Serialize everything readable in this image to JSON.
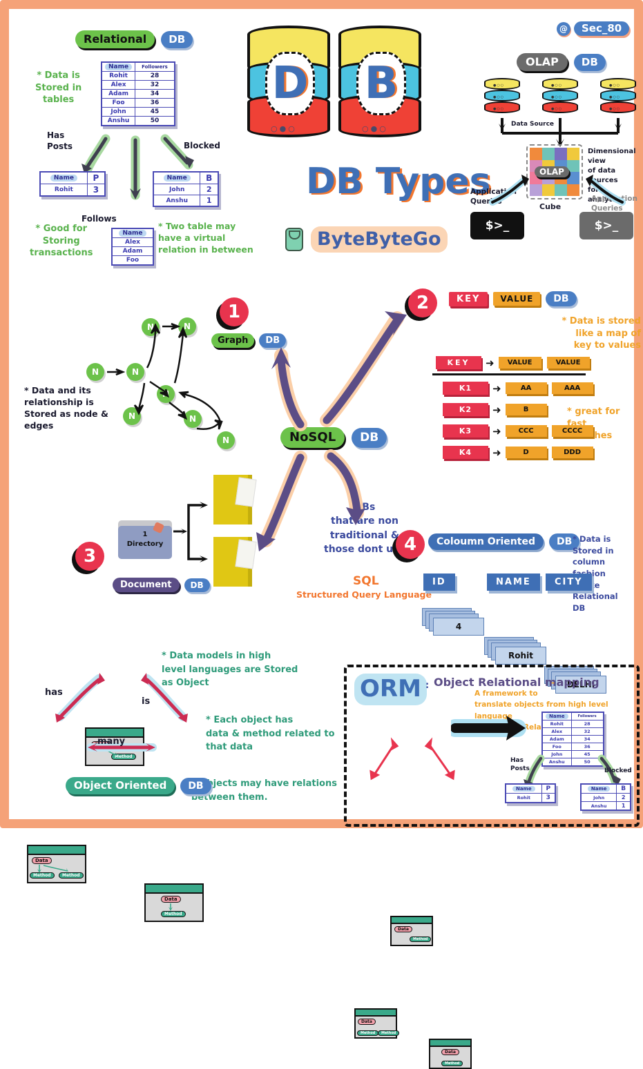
{
  "page": {
    "title": "DB Types",
    "brand": "ByteByteGo",
    "handle": "Sec_80",
    "at_symbol": "@",
    "frame_color": "#f5a278"
  },
  "relational": {
    "badge": "Relational",
    "db_badge": "DB",
    "note_left": "* Data is\nStored in\ntables",
    "note_bottom_left": "* Good for\nStoring\ntransactions",
    "note_right": "* Two table may\nhave a virtual\nrelation in between",
    "arrow_labels": {
      "left": "Has\nPosts",
      "center": "Follows",
      "right": "Blocked"
    },
    "main_table": {
      "headers": [
        "Name",
        "Followers"
      ],
      "rows": [
        [
          "Rohit",
          "28"
        ],
        [
          "Alex",
          "32"
        ],
        [
          "Adam",
          "34"
        ],
        [
          "Foo",
          "36"
        ],
        [
          "John",
          "45"
        ],
        [
          "Anshu",
          "50"
        ]
      ]
    },
    "posts_table": {
      "headers": [
        "Name",
        "P"
      ],
      "rows": [
        [
          "Rohit",
          "3"
        ]
      ]
    },
    "blocked_table": {
      "headers": [
        "Name",
        "B"
      ],
      "rows": [
        [
          "John",
          "2"
        ],
        [
          "Anshu",
          "1"
        ]
      ]
    },
    "follows_table": {
      "headers": [
        "Name"
      ],
      "rows": [
        [
          "Alex"
        ],
        [
          "Adam"
        ],
        [
          "Foo"
        ]
      ]
    }
  },
  "olap": {
    "badge": "OLAP",
    "db_badge": "DB",
    "data_source_label": "Data Source",
    "cube_label": "OLAP",
    "cube_caption": "Cube",
    "dimensional_note": "Dimensional view\nof data sources\nfor analytics",
    "query_left": "Application\nQueries",
    "query_right": "Application\nQueries",
    "terminal_prompt": "$>_"
  },
  "graph": {
    "step": "1",
    "badge": "Graph",
    "db_badge": "DB",
    "note": "* Data and its\nrelationship is\nStored as node &\nedges",
    "node_label": "N"
  },
  "keyvalue": {
    "step": "2",
    "key_badge": "KEY",
    "value_badge": "VALUE",
    "db_badge": "DB",
    "note_top": "* Data is stored\nlike a map of\nkey to values",
    "note_bottom": "* great for\nfast searches",
    "header_row": {
      "key": "KEY",
      "values": [
        "VALUE",
        "VALUE"
      ]
    },
    "rows": [
      {
        "key": "K1",
        "values": [
          "AA",
          "AAA"
        ]
      },
      {
        "key": "K2",
        "values": [
          "B"
        ]
      },
      {
        "key": "K3",
        "values": [
          "CCC",
          "CCCC"
        ]
      },
      {
        "key": "K4",
        "values": [
          "D",
          "DDD"
        ]
      }
    ]
  },
  "document": {
    "step": "3",
    "badge": "Document",
    "db_badge": "DB",
    "folder_label": "1\nDirectory"
  },
  "nosql": {
    "badge": "NoSQL",
    "db_badge": "DB",
    "description": "DBs\nthat are non\ntraditional &\nthose dont use",
    "sql_word": "SQL",
    "sql_expansion": "Structured Query Language"
  },
  "column": {
    "step": "4",
    "badge": "Coloumn Oriented",
    "db_badge": "DB",
    "note": "* Data is\nStored in column\nfashion unlike\nRelational\nDB",
    "columns": [
      {
        "header": "ID",
        "value": "4"
      },
      {
        "header": "NAME",
        "value": "Rohit"
      },
      {
        "header": "CITY",
        "value": "DELHI"
      }
    ]
  },
  "object_oriented": {
    "badge": "Object Oriented",
    "db_badge": "DB",
    "note_1": "* Data models in high\nlevel languages are Stored\nas Object",
    "note_2": "* Each object has\ndata & method related to\nthat data",
    "note_3": "* Objects may have relations\nbetween them.",
    "relations": {
      "has": "has",
      "is": "is",
      "many": "many"
    },
    "box_labels": {
      "data": "Data",
      "method": "Method"
    }
  },
  "orm": {
    "title": "ORM",
    "separator": ":",
    "definition": "Object Relational mapping",
    "dash": "-",
    "description": "A framework to\ntranslate objects from high level language\nto tables in Relational DB",
    "box_labels": {
      "data": "Data",
      "method": "Method"
    },
    "arrow_labels": {
      "left": "Has\nPosts",
      "right": "Blocked"
    },
    "main_table": {
      "headers": [
        "Name",
        "Followers"
      ],
      "rows": [
        [
          "Rohit",
          "28"
        ],
        [
          "Alex",
          "32"
        ],
        [
          "Adam",
          "34"
        ],
        [
          "Foo",
          "36"
        ],
        [
          "John",
          "45"
        ],
        [
          "Anshu",
          "50"
        ]
      ]
    },
    "posts_table": {
      "headers": [
        "Name",
        "P"
      ],
      "rows": [
        [
          "Rohit",
          "3"
        ]
      ]
    },
    "blocked_table": {
      "headers": [
        "Name",
        "B"
      ],
      "rows": [
        [
          "John",
          "2"
        ],
        [
          "Anshu",
          "1"
        ]
      ]
    }
  }
}
